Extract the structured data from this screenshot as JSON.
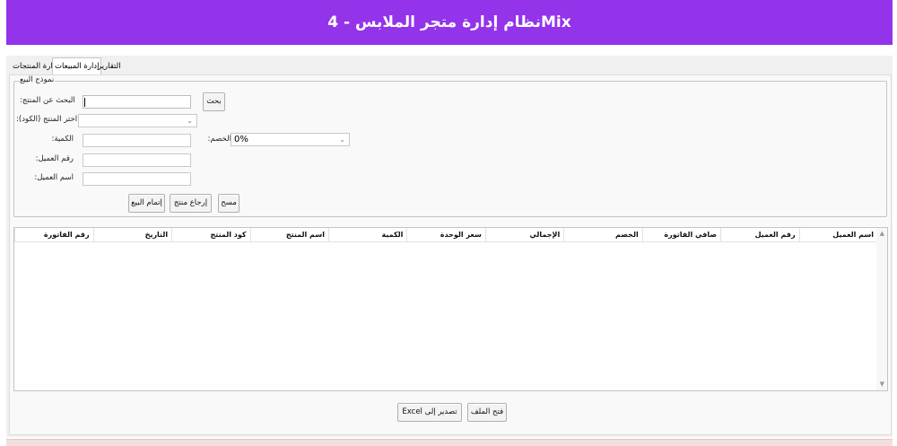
{
  "app": {
    "title": "نظام إدارة متجر الملابس - 4Mix"
  },
  "tabs": [
    {
      "label": "التقارير"
    },
    {
      "label": "إدارة المبيعات"
    },
    {
      "label": "إدارة المنتجات"
    }
  ],
  "sale_form": {
    "legend": "نموذج البيع",
    "search_label": ":البحث عن المنتج",
    "search_value": "",
    "search_button": "بحث",
    "product_select_label": ":اختر المنتج (الكود)",
    "product_select_value": "",
    "quantity_label": ":الكمية",
    "quantity_value": "",
    "discount_label": ":الخصم",
    "discount_value": "0%",
    "customer_number_label": ":رقم العميل",
    "customer_number_value": "",
    "customer_name_label": ":اسم العميل",
    "customer_name_value": "",
    "clear_button": "مسح",
    "return_button": "إرجاع منتج",
    "complete_button": "إتمام البيع"
  },
  "sales_table": {
    "columns": [
      "اسم العميل",
      "رقم العميل",
      "صافي الفاتورة",
      "الخصم",
      "الإجمالي",
      "سعر الوحدة",
      "الكمية",
      "اسم المنتج",
      "كود المنتج",
      "التاريخ",
      "رقم الفاتورة"
    ],
    "rows": []
  },
  "actions": {
    "open_file": "فتح الملف",
    "export_excel": "Excel تصدير إلى"
  },
  "colors": {
    "header": "#9333ea",
    "footer": "#f3dede"
  }
}
